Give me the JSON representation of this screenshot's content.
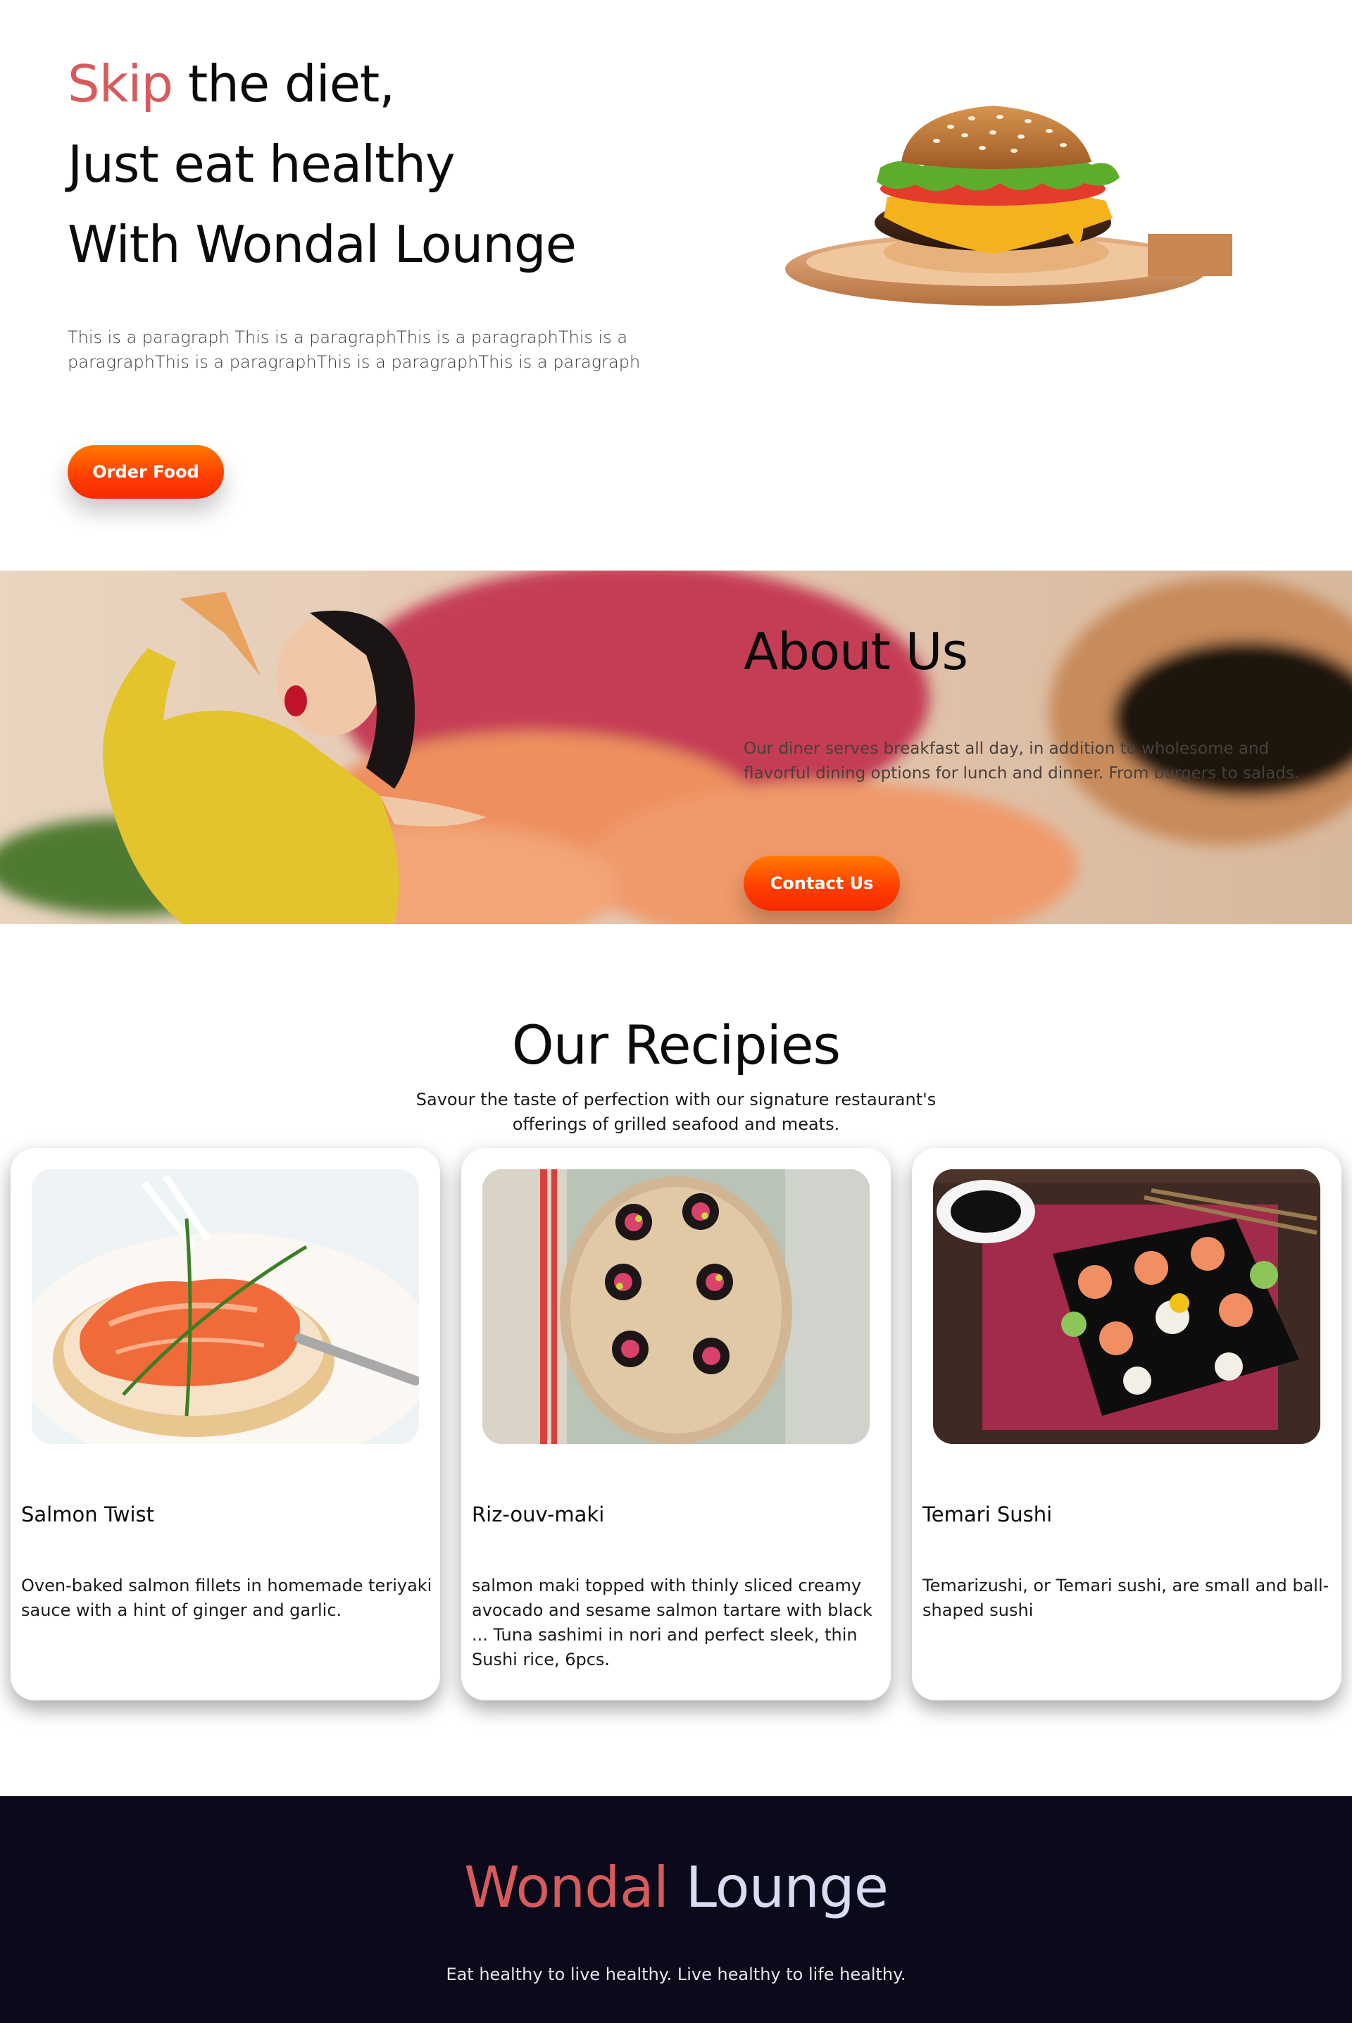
{
  "hero": {
    "title_accent": "Skip",
    "title_rest": " the diet,",
    "title_line2": "Just eat healthy",
    "title_line3": "With Wondal Lounge",
    "paragraph": "This is a paragraph This is a paragraphThis is a paragraphThis is a paragraphThis is a paragraphThis is a paragraphThis is a paragraph",
    "order_button": "Order Food"
  },
  "about": {
    "title": "About Us",
    "paragraph": "Our diner serves breakfast all day, in addition to wholesome and flavorful dining options for lunch and dinner. From burgers to salads.",
    "contact_button": "Contact Us"
  },
  "recipes": {
    "title": "Our Recipies",
    "subtitle": "Savour the taste of perfection with our signature restaurant's offerings of grilled seafood and meats.",
    "cards": [
      {
        "title": "Salmon Twist",
        "description": "Oven-baked salmon fillets in homemade teriyaki sauce with a hint of ginger and garlic."
      },
      {
        "title": "Riz-ouv-maki",
        "description": "salmon maki topped with thinly sliced creamy avocado and sesame salmon tartare with black ... Tuna sashimi in nori and perfect sleek, thin Sushi rice, 6pcs."
      },
      {
        "title": "Temari Sushi",
        "description": "Temarizushi, or Temari sushi, are small and ball-shaped sushi"
      }
    ]
  },
  "footer": {
    "brand_first": "Wondal",
    "brand_second": " Lounge",
    "tagline": "Eat healthy to live healthy. Live healthy to life healthy."
  },
  "colors": {
    "accent": "#d75b5c",
    "button_gradient_top": "#ff7a00",
    "button_gradient_bottom": "#f52a00",
    "footer_bg": "#0a0a1a",
    "footer_brand_second": "#d9dcf2"
  }
}
